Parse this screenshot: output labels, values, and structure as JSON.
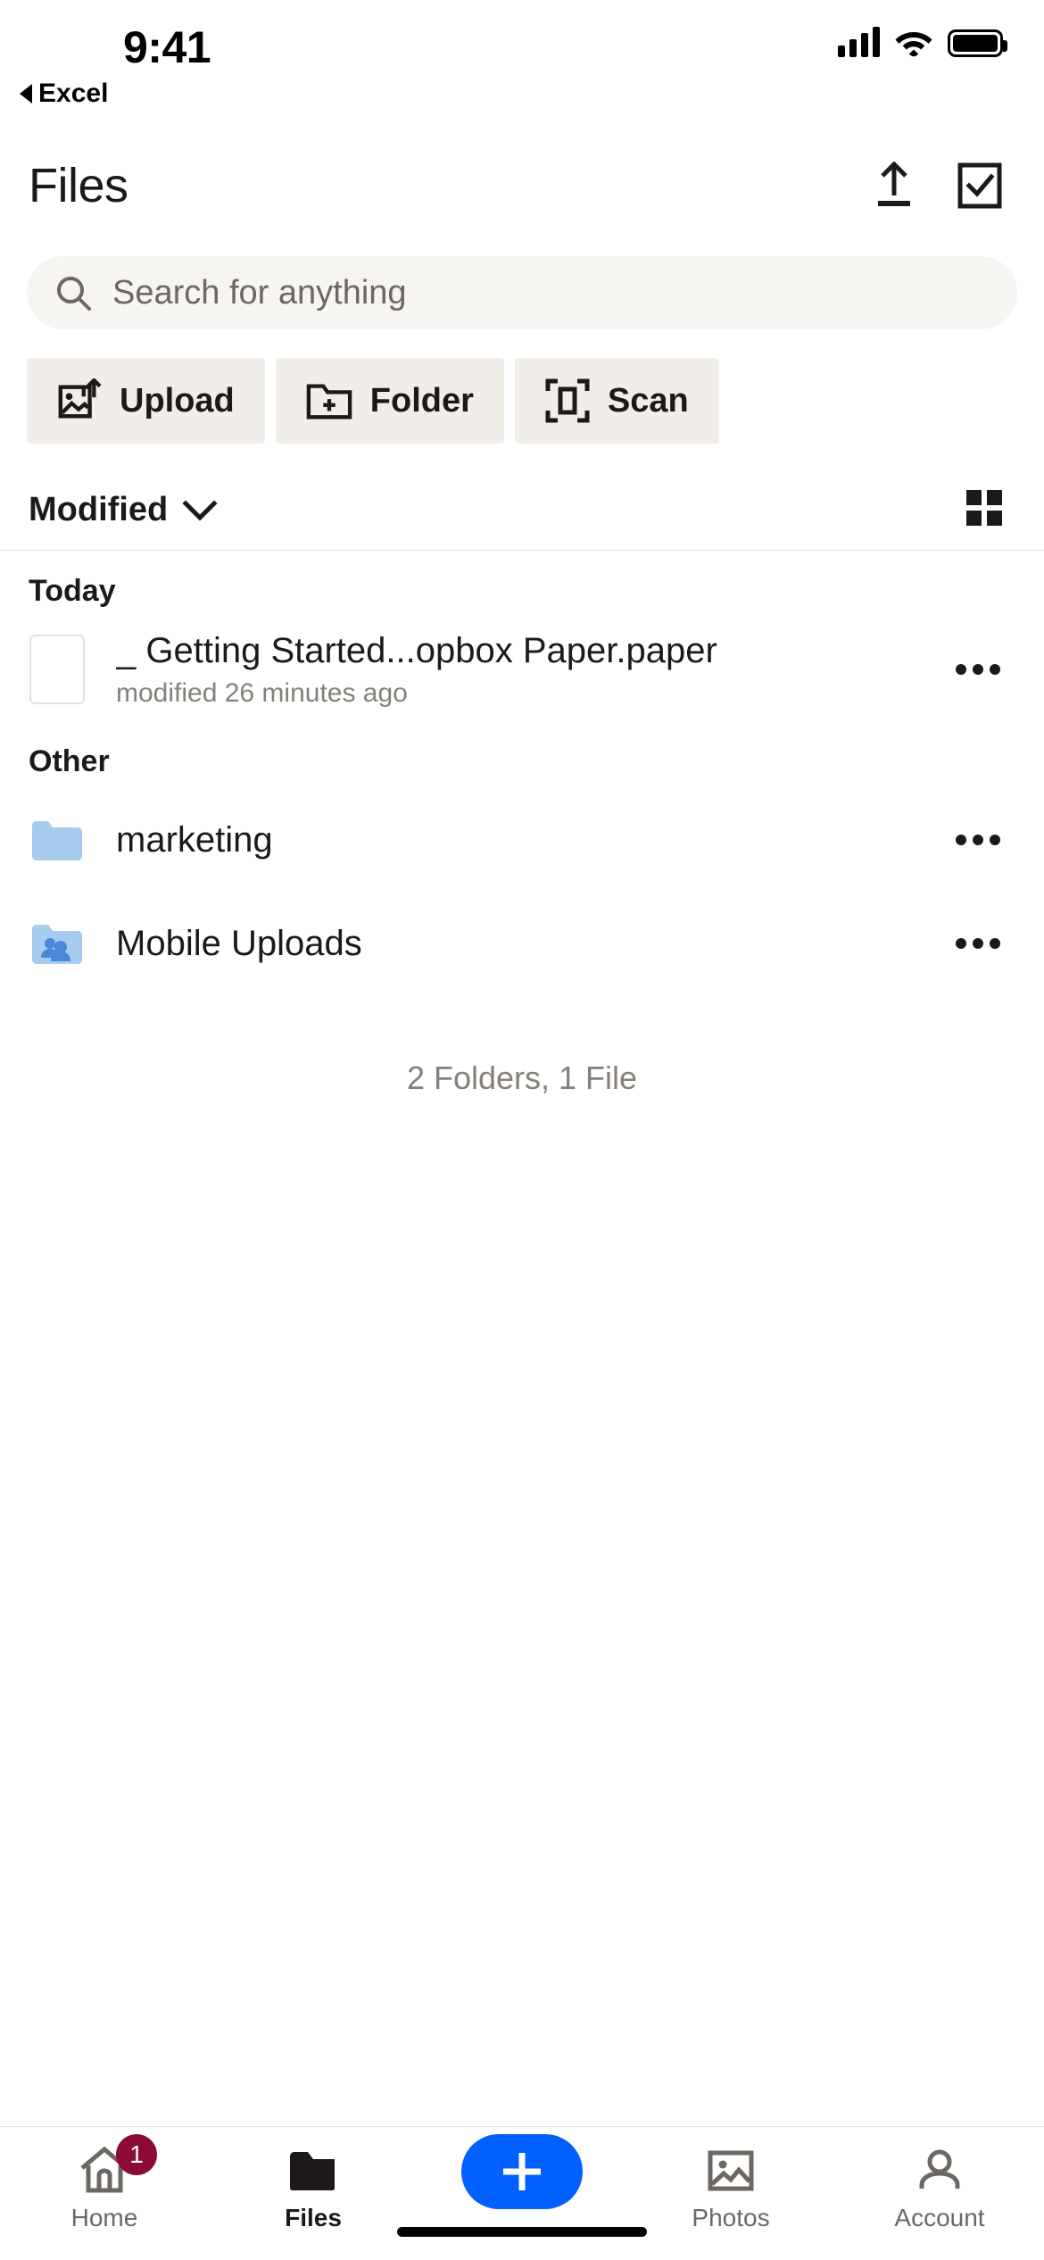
{
  "status_bar": {
    "time": "9:41",
    "back_app_label": "Excel",
    "signal_icon": "cellular-signal-icon",
    "wifi_icon": "wifi-icon",
    "battery_icon": "battery-full-icon"
  },
  "header": {
    "title": "Files",
    "upload_icon": "upload-icon",
    "select_icon": "select-checkbox-icon"
  },
  "search": {
    "placeholder": "Search for anything",
    "value": "",
    "icon": "search-icon"
  },
  "quick_actions": [
    {
      "label": "Upload",
      "icon": "image-upload-icon"
    },
    {
      "label": "Folder",
      "icon": "folder-plus-icon"
    },
    {
      "label": "Scan",
      "icon": "document-scan-icon"
    }
  ],
  "sort": {
    "label": "Modified",
    "chevron_icon": "chevron-down-icon",
    "view_toggle_icon": "grid-view-icon"
  },
  "sections": [
    {
      "heading": "Today",
      "items": [
        {
          "name": "_ Getting Started...opbox Paper.paper",
          "subtitle": "modified 26 minutes ago",
          "icon": "paper-document-thumbnail",
          "overflow_icon": "more-options-icon"
        }
      ]
    },
    {
      "heading": "Other",
      "items": [
        {
          "name": "marketing",
          "subtitle": "",
          "icon": "folder-icon",
          "overflow_icon": "more-options-icon"
        },
        {
          "name": "Mobile Uploads",
          "subtitle": "",
          "icon": "shared-folder-icon",
          "overflow_icon": "more-options-icon"
        }
      ]
    }
  ],
  "summary": "2 Folders, 1 File",
  "tabbar": {
    "tabs": [
      {
        "label": "Home",
        "icon": "home-icon",
        "badge": "1",
        "active": false
      },
      {
        "label": "Files",
        "icon": "folder-filled-icon",
        "badge": "",
        "active": true
      },
      {
        "label": "Photos",
        "icon": "photos-icon",
        "badge": "",
        "active": false
      },
      {
        "label": "Account",
        "icon": "person-icon",
        "badge": "",
        "active": false
      }
    ],
    "create_button": {
      "icon": "plus-icon",
      "label": ""
    }
  },
  "colors": {
    "accent_blue": "#0061fe",
    "badge_red": "#8c0a33",
    "chip_bg": "#f1eeea",
    "search_bg": "#f7f5f2",
    "folder_blue": "#a8cbf0",
    "text_primary": "#1e1919",
    "text_secondary": "#86807a"
  }
}
